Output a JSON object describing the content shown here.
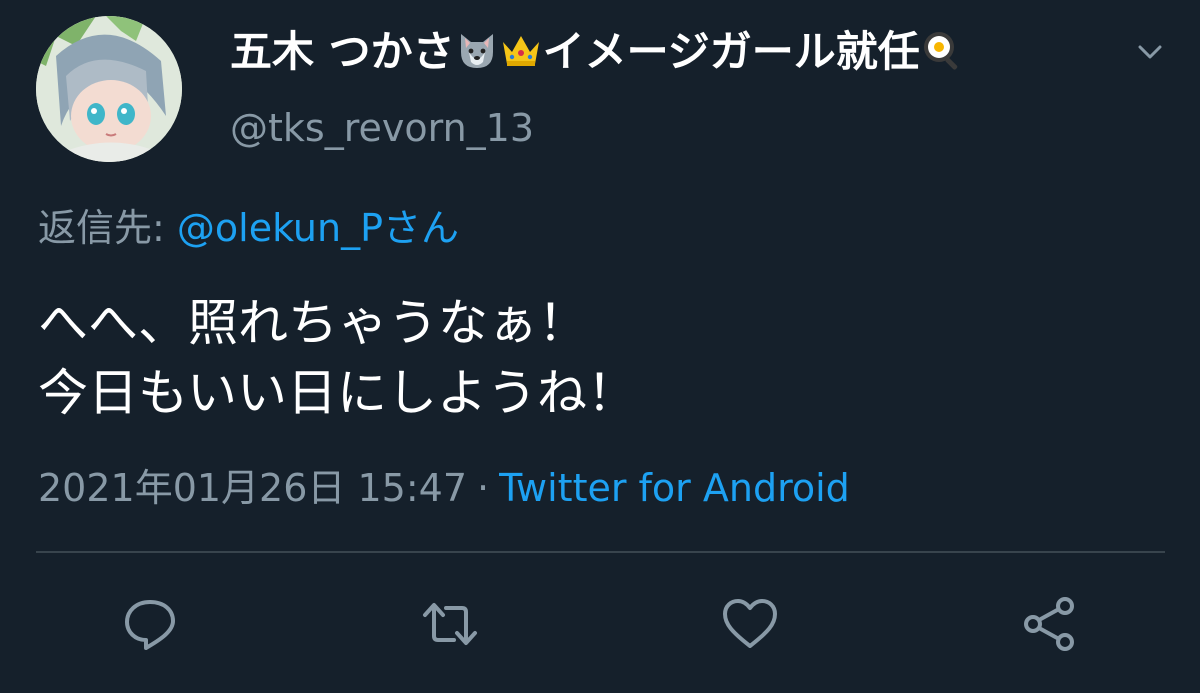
{
  "tweet": {
    "author_name": "五木 つかさ",
    "author_name_suffix": "イメージガール就任",
    "name_emojis": [
      "wolf-face-icon",
      "crown-icon",
      "frying-pan-egg-icon"
    ],
    "handle": "@tks_revorn_13",
    "reply_label": "返信先:",
    "reply_target": "@olekun_Pさん",
    "text_lines": [
      "へへ、照れちゃうなぁ！",
      "今日もいい日にしようね！"
    ],
    "timestamp": "2021年01月26日 15:47",
    "separator": "·",
    "source": "Twitter for Android"
  },
  "actions": [
    "reply-icon",
    "retweet-icon",
    "like-icon",
    "share-icon"
  ],
  "colors": {
    "background": "#15202b",
    "text_primary": "#ffffff",
    "text_secondary": "#8899a6",
    "accent": "#1da1f2",
    "divider": "#38444d"
  }
}
